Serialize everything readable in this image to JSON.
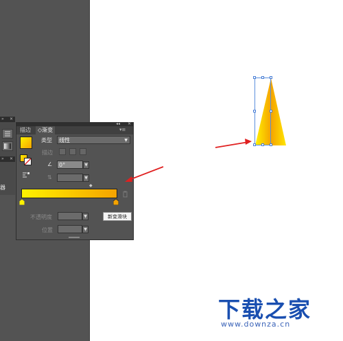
{
  "panel": {
    "tabs": [
      {
        "label": "描边"
      },
      {
        "label": "渐变"
      }
    ],
    "type_label": "类型",
    "type_value": "线性",
    "stroke_label": "描边",
    "angle_value": "0°",
    "opacity_label": "不透明度",
    "location_label": "位置",
    "gradient_colors": [
      "#fff200",
      "#f5a300"
    ]
  },
  "dock": {
    "label": "器"
  },
  "tooltip": {
    "text": "新变滑块"
  },
  "watermark": {
    "title": "下载之家",
    "subtitle": "www.downza.cn"
  },
  "colors": {
    "annotation_arrow": "#e02020",
    "selection": "#4a7fd6",
    "workspace": "#535353"
  }
}
